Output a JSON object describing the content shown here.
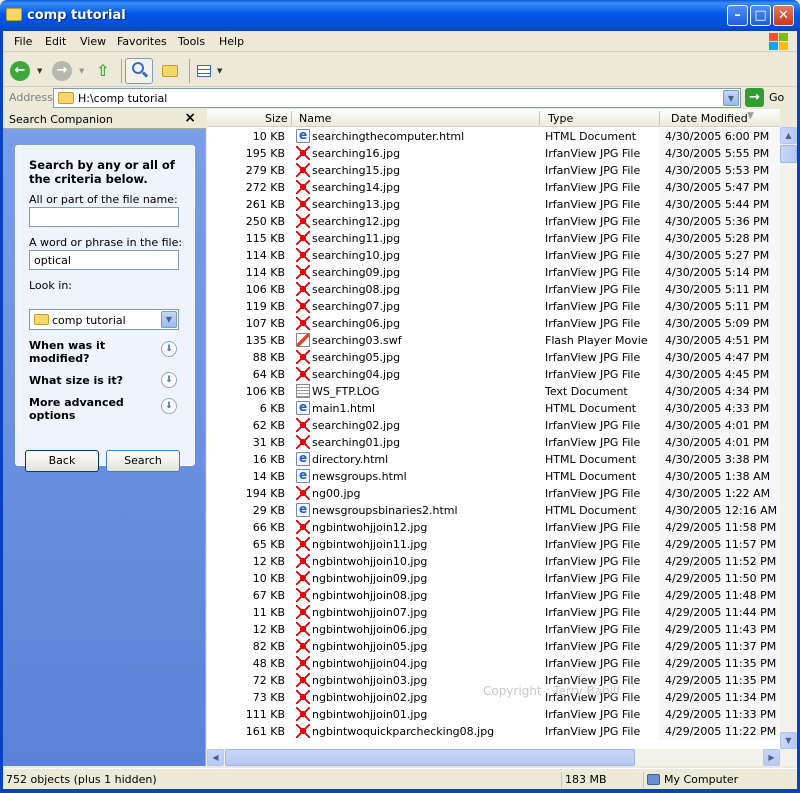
{
  "window": {
    "title": "comp tutorial"
  },
  "menu": [
    "File",
    "Edit",
    "View",
    "Favorites",
    "Tools",
    "Help"
  ],
  "address": {
    "label": "Address",
    "value": "H:\\comp tutorial",
    "go_label": "Go"
  },
  "search": {
    "header": "Search Companion",
    "heading": "Search by any or all of the criteria below.",
    "filename_label": "All or part of the file name:",
    "filename_value": "",
    "phrase_label": "A word or phrase in the file:",
    "phrase_value": "optical",
    "lookin_label": "Look in:",
    "lookin_value": "comp tutorial",
    "opt_modified": "When was it modified?",
    "opt_size": "What size is it?",
    "opt_advanced": "More advanced options",
    "back_label": "Back",
    "search_label": "Search"
  },
  "columns": {
    "size": "Size",
    "name": "Name",
    "type": "Type",
    "date": "Date Modified"
  },
  "files": [
    {
      "size": "10 KB",
      "name": "searchingthecomputer.html",
      "type": "HTML Document",
      "date": "4/30/2005 6:00 PM",
      "icon": "html"
    },
    {
      "size": "195 KB",
      "name": "searching16.jpg",
      "type": "IrfanView JPG File",
      "date": "4/30/2005 5:55 PM",
      "icon": "jpg"
    },
    {
      "size": "279 KB",
      "name": "searching15.jpg",
      "type": "IrfanView JPG File",
      "date": "4/30/2005 5:53 PM",
      "icon": "jpg"
    },
    {
      "size": "272 KB",
      "name": "searching14.jpg",
      "type": "IrfanView JPG File",
      "date": "4/30/2005 5:47 PM",
      "icon": "jpg"
    },
    {
      "size": "261 KB",
      "name": "searching13.jpg",
      "type": "IrfanView JPG File",
      "date": "4/30/2005 5:44 PM",
      "icon": "jpg"
    },
    {
      "size": "250 KB",
      "name": "searching12.jpg",
      "type": "IrfanView JPG File",
      "date": "4/30/2005 5:36 PM",
      "icon": "jpg"
    },
    {
      "size": "115 KB",
      "name": "searching11.jpg",
      "type": "IrfanView JPG File",
      "date": "4/30/2005 5:28 PM",
      "icon": "jpg"
    },
    {
      "size": "114 KB",
      "name": "searching10.jpg",
      "type": "IrfanView JPG File",
      "date": "4/30/2005 5:27 PM",
      "icon": "jpg"
    },
    {
      "size": "114 KB",
      "name": "searching09.jpg",
      "type": "IrfanView JPG File",
      "date": "4/30/2005 5:14 PM",
      "icon": "jpg"
    },
    {
      "size": "106 KB",
      "name": "searching08.jpg",
      "type": "IrfanView JPG File",
      "date": "4/30/2005 5:11 PM",
      "icon": "jpg"
    },
    {
      "size": "119 KB",
      "name": "searching07.jpg",
      "type": "IrfanView JPG File",
      "date": "4/30/2005 5:11 PM",
      "icon": "jpg"
    },
    {
      "size": "107 KB",
      "name": "searching06.jpg",
      "type": "IrfanView JPG File",
      "date": "4/30/2005 5:09 PM",
      "icon": "jpg"
    },
    {
      "size": "135 KB",
      "name": "searching03.swf",
      "type": "Flash Player Movie",
      "date": "4/30/2005 4:51 PM",
      "icon": "swf"
    },
    {
      "size": "88 KB",
      "name": "searching05.jpg",
      "type": "IrfanView JPG File",
      "date": "4/30/2005 4:47 PM",
      "icon": "jpg"
    },
    {
      "size": "64 KB",
      "name": "searching04.jpg",
      "type": "IrfanView JPG File",
      "date": "4/30/2005 4:45 PM",
      "icon": "jpg"
    },
    {
      "size": "106 KB",
      "name": "WS_FTP.LOG",
      "type": "Text Document",
      "date": "4/30/2005 4:34 PM",
      "icon": "txt"
    },
    {
      "size": "6 KB",
      "name": "main1.html",
      "type": "HTML Document",
      "date": "4/30/2005 4:33 PM",
      "icon": "html"
    },
    {
      "size": "62 KB",
      "name": "searching02.jpg",
      "type": "IrfanView JPG File",
      "date": "4/30/2005 4:01 PM",
      "icon": "jpg"
    },
    {
      "size": "31 KB",
      "name": "searching01.jpg",
      "type": "IrfanView JPG File",
      "date": "4/30/2005 4:01 PM",
      "icon": "jpg"
    },
    {
      "size": "16 KB",
      "name": "directory.html",
      "type": "HTML Document",
      "date": "4/30/2005 3:38 PM",
      "icon": "html"
    },
    {
      "size": "14 KB",
      "name": "newsgroups.html",
      "type": "HTML Document",
      "date": "4/30/2005 1:38 AM",
      "icon": "html"
    },
    {
      "size": "194 KB",
      "name": "ng00.jpg",
      "type": "IrfanView JPG File",
      "date": "4/30/2005 1:22 AM",
      "icon": "jpg"
    },
    {
      "size": "29 KB",
      "name": "newsgroupsbinaries2.html",
      "type": "HTML Document",
      "date": "4/30/2005 12:16 AM",
      "icon": "html"
    },
    {
      "size": "66 KB",
      "name": "ngbintwohjjoin12.jpg",
      "type": "IrfanView JPG File",
      "date": "4/29/2005 11:58 PM",
      "icon": "jpg"
    },
    {
      "size": "65 KB",
      "name": "ngbintwohjjoin11.jpg",
      "type": "IrfanView JPG File",
      "date": "4/29/2005 11:57 PM",
      "icon": "jpg"
    },
    {
      "size": "12 KB",
      "name": "ngbintwohjjoin10.jpg",
      "type": "IrfanView JPG File",
      "date": "4/29/2005 11:52 PM",
      "icon": "jpg"
    },
    {
      "size": "10 KB",
      "name": "ngbintwohjjoin09.jpg",
      "type": "IrfanView JPG File",
      "date": "4/29/2005 11:50 PM",
      "icon": "jpg"
    },
    {
      "size": "67 KB",
      "name": "ngbintwohjjoin08.jpg",
      "type": "IrfanView JPG File",
      "date": "4/29/2005 11:48 PM",
      "icon": "jpg"
    },
    {
      "size": "11 KB",
      "name": "ngbintwohjjoin07.jpg",
      "type": "IrfanView JPG File",
      "date": "4/29/2005 11:44 PM",
      "icon": "jpg"
    },
    {
      "size": "12 KB",
      "name": "ngbintwohjjoin06.jpg",
      "type": "IrfanView JPG File",
      "date": "4/29/2005 11:43 PM",
      "icon": "jpg"
    },
    {
      "size": "82 KB",
      "name": "ngbintwohjjoin05.jpg",
      "type": "IrfanView JPG File",
      "date": "4/29/2005 11:37 PM",
      "icon": "jpg"
    },
    {
      "size": "48 KB",
      "name": "ngbintwohjjoin04.jpg",
      "type": "IrfanView JPG File",
      "date": "4/29/2005 11:35 PM",
      "icon": "jpg"
    },
    {
      "size": "72 KB",
      "name": "ngbintwohjjoin03.jpg",
      "type": "IrfanView JPG File",
      "date": "4/29/2005 11:35 PM",
      "icon": "jpg"
    },
    {
      "size": "73 KB",
      "name": "ngbintwohjjoin02.jpg",
      "type": "IrfanView JPG File",
      "date": "4/29/2005 11:34 PM",
      "icon": "jpg"
    },
    {
      "size": "111 KB",
      "name": "ngbintwohjjoin01.jpg",
      "type": "IrfanView JPG File",
      "date": "4/29/2005 11:33 PM",
      "icon": "jpg"
    },
    {
      "size": "161 KB",
      "name": "ngbintwoquickparchecking08.jpg",
      "type": "IrfanView JPG File",
      "date": "4/29/2005 11:22 PM",
      "icon": "jpg"
    }
  ],
  "watermark": "Copyright : Terry Bahill",
  "status": {
    "objects": "752 objects (plus 1 hidden)",
    "size": "183 MB",
    "location": "My Computer"
  },
  "colors": {
    "titlebar": "#0058e6",
    "pane": "#6f94e2",
    "chrome": "#ece9d8"
  }
}
